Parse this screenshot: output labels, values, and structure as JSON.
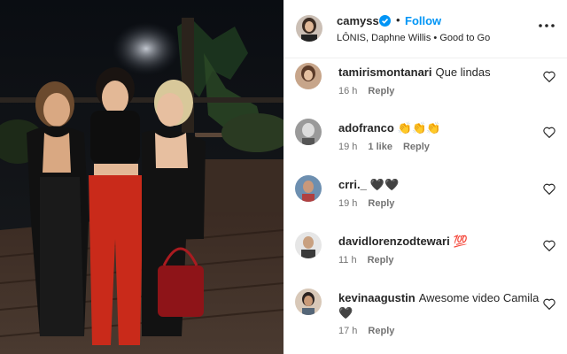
{
  "post": {
    "username": "camyss",
    "follow_label": "Follow",
    "dot": "•",
    "subtitle": "LÔNIS, Daphne Willis • Good to Go"
  },
  "comments": [
    {
      "user": "tamirismontanari",
      "text": "Que lindas",
      "time": "16 h",
      "likes": "",
      "reply": "Reply"
    },
    {
      "user": "adofranco",
      "text": "👏👏👏",
      "time": "19 h",
      "likes": "1 like",
      "reply": "Reply"
    },
    {
      "user": "crri._",
      "text": "🖤🖤",
      "time": "19 h",
      "likes": "",
      "reply": "Reply"
    },
    {
      "user": "davidlorenzodtewari",
      "text": "💯",
      "time": "11 h",
      "likes": "",
      "reply": "Reply"
    },
    {
      "user": "kevinaagustin",
      "text": "Awesome video Camila 🖤",
      "time": "17 h",
      "likes": "",
      "reply": "Reply"
    }
  ],
  "colors": {
    "accent": "#0095f6",
    "text": "#262626",
    "muted": "#737373",
    "divider": "#efefef"
  },
  "icons": [
    "verified-badge-icon",
    "more-options-icon",
    "heart-icon"
  ]
}
